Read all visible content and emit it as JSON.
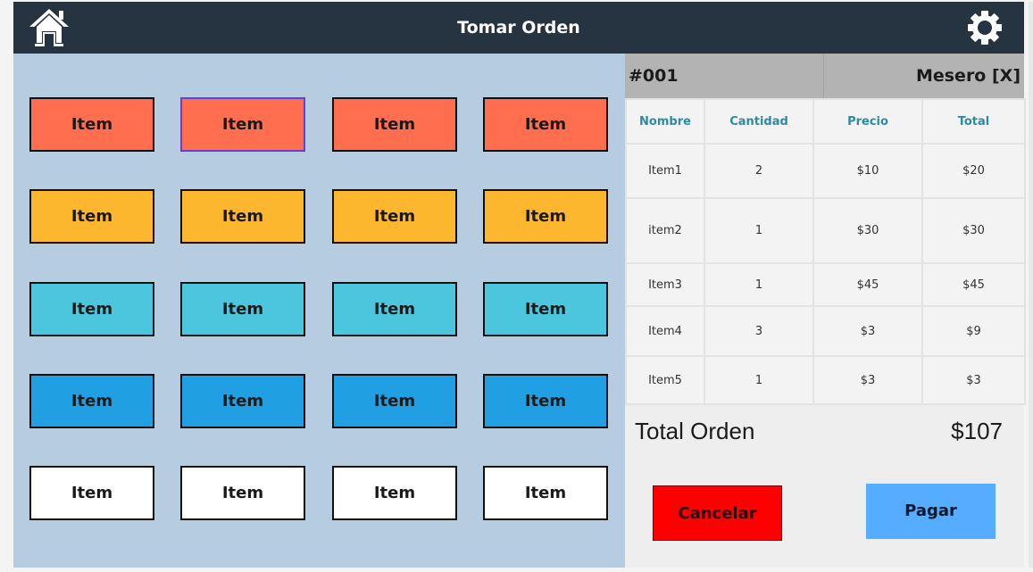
{
  "header": {
    "title": "Tomar Orden",
    "home_icon": "home-icon",
    "settings_icon": "gear-icon"
  },
  "item_grid": {
    "rows": [
      {
        "color": "#ff6f4f",
        "items": [
          "Item",
          "Item",
          "Item",
          "Item"
        ]
      },
      {
        "color": "#fdb72f",
        "items": [
          "Item",
          "Item",
          "Item",
          "Item"
        ]
      },
      {
        "color": "#4cc6dc",
        "items": [
          "Item",
          "Item",
          "Item",
          "Item"
        ]
      },
      {
        "color": "#20a0e3",
        "items": [
          "Item",
          "Item",
          "Item",
          "Item"
        ]
      },
      {
        "color": "#ffffff",
        "items": [
          "Item",
          "Item",
          "Item",
          "Item"
        ]
      }
    ],
    "selected": {
      "row": 0,
      "col": 1
    }
  },
  "order": {
    "number": "#001",
    "waiter": "Mesero [X]",
    "columns": [
      "Nombre",
      "Cantidad",
      "Precio",
      "Total"
    ],
    "rows": [
      [
        "Item1",
        "2",
        "$10",
        "$20"
      ],
      [
        "item2",
        "1",
        "$30",
        "$30"
      ],
      [
        "Item3",
        "1",
        "$45",
        "$45"
      ],
      [
        "Item4",
        "3",
        "$3",
        "$9"
      ],
      [
        "Item5",
        "1",
        "$3",
        "$3"
      ]
    ],
    "total_label": "Total Orden",
    "total_value": "$107"
  },
  "actions": {
    "cancel_label": "Cancelar",
    "pay_label": "Pagar"
  },
  "colors": {
    "header_bg": "#263340",
    "grid_bg": "#b6cce0",
    "cancel": "#ff0000",
    "pay": "#56adff",
    "table_header_text": "#2c8aa5"
  }
}
